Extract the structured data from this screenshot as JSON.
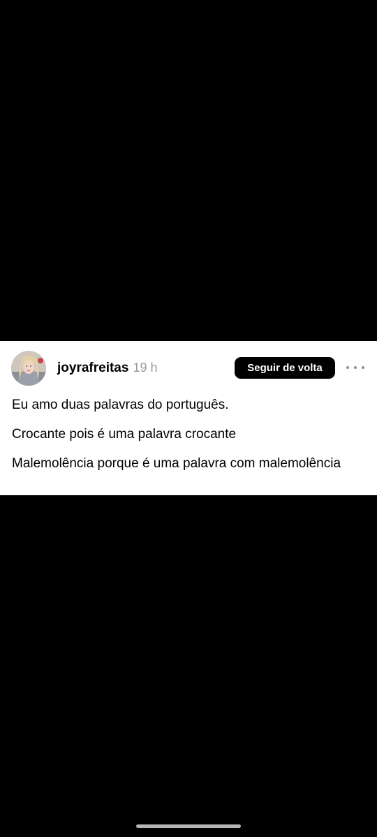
{
  "post": {
    "author": {
      "username": "joyrafreitas",
      "avatar_icon": "profile-photo"
    },
    "timestamp": "19 h",
    "follow_button_label": "Seguir de volta",
    "more_icon": "more-horizontal-icon",
    "paragraphs": [
      "Eu amo duas palavras do português.",
      "Crocante pois é uma palavra crocante",
      "Malemolência porque é uma palavra com malemolência"
    ]
  },
  "colors": {
    "background": "#000000",
    "card": "#ffffff",
    "text": "#000000",
    "muted": "#9a9a9a",
    "button_bg": "#000000",
    "button_text": "#ffffff",
    "home_indicator": "#b5b5b5"
  }
}
